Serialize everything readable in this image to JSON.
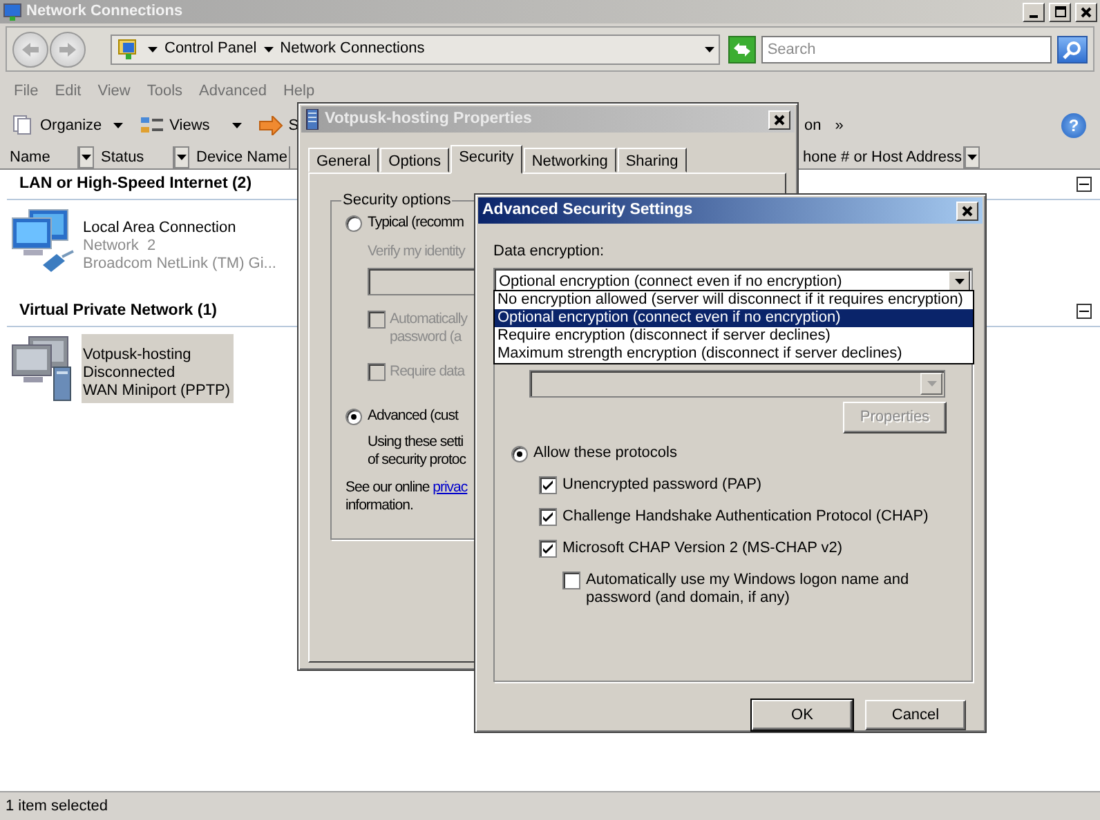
{
  "window": {
    "title": "Network Connections"
  },
  "address_bar": {
    "crumbs": [
      "Control Panel",
      "Network Connections"
    ]
  },
  "search": {
    "placeholder": "Search"
  },
  "menu": [
    "File",
    "Edit",
    "View",
    "Tools",
    "Advanced",
    "Help"
  ],
  "toolbar": [
    {
      "kind": "organize",
      "label": "Organize"
    },
    {
      "kind": "views",
      "label": "Views"
    },
    {
      "kind": "arrow",
      "label": "S"
    },
    {
      "kind": "text",
      "label": "on"
    },
    {
      "kind": "text",
      "label": "»"
    }
  ],
  "help": "?",
  "columns": [
    {
      "label": "Name"
    },
    {
      "label": "Status"
    },
    {
      "label": "Device Name"
    },
    {
      "label": "hone # or Host Address"
    }
  ],
  "groups": [
    {
      "title": "LAN or High-Speed Internet (2)",
      "expanded": true,
      "items": [
        {
          "kind": "lan",
          "name": "Local Area Connection",
          "status": "Network  2",
          "device": "Broadcom NetLink (TM) Gi...",
          "selected": false
        }
      ]
    },
    {
      "title": "Virtual Private Network (1)",
      "expanded": true,
      "items": [
        {
          "kind": "vpn",
          "name": "Votpusk-hosting",
          "status": "Disconnected",
          "device": "WAN Miniport (PPTP)",
          "selected": true
        }
      ]
    }
  ],
  "status_bar": "1 item selected",
  "properties_dialog": {
    "title": "Votpusk-hosting Properties",
    "tabs": [
      {
        "label": "General",
        "selected": false
      },
      {
        "label": "Options",
        "selected": false
      },
      {
        "label": "Security",
        "selected": true
      },
      {
        "label": "Networking",
        "selected": false
      },
      {
        "label": "Sharing",
        "selected": false
      }
    ],
    "group_title": "Security options",
    "typical": {
      "label": "Typical (recomm",
      "selected": false
    },
    "verify": {
      "label": "Verify my identity",
      "disabled": true
    },
    "typical_checks": [
      {
        "label": "Automatically\npassword (a",
        "checked": false,
        "disabled": true
      },
      {
        "label": "Require data",
        "checked": false,
        "disabled": true
      }
    ],
    "advanced": {
      "label": "Advanced (cust",
      "selected": true
    },
    "advanced_note": "Using these setti\nof security protoc",
    "privacy_note": {
      "text": "See our online ",
      "link": "privac",
      "rest": "information."
    }
  },
  "advanced_dialog": {
    "title": "Advanced Security Settings",
    "encryption_label": "Data encryption:",
    "encryption": {
      "value": "Optional encryption (connect even if no encryption)",
      "expanded": true,
      "options": [
        {
          "label": "No encryption allowed (server will disconnect if it requires encryption)",
          "selected": false
        },
        {
          "label": "Optional encryption (connect even if no encryption)",
          "selected": true
        },
        {
          "label": "Require encryption (disconnect if server declines)",
          "selected": false
        },
        {
          "label": "Maximum strength encryption (disconnect if server declines)",
          "selected": false
        }
      ]
    },
    "properties_button": {
      "label": "Properties",
      "disabled": true
    },
    "allow_protocols": {
      "label": "Allow these protocols",
      "selected": true
    },
    "protocols": [
      {
        "label": "Unencrypted password (PAP)",
        "checked": true
      },
      {
        "label": "Challenge Handshake Authentication Protocol (CHAP)",
        "checked": true
      },
      {
        "label": "Microsoft CHAP Version 2 (MS-CHAP v2)",
        "checked": true,
        "children": [
          {
            "label": "Automatically use my Windows logon name and password (and domain, if any)",
            "checked": false
          }
        ]
      }
    ],
    "buttons": [
      {
        "label": "OK",
        "default": true
      },
      {
        "label": "Cancel",
        "default": false
      }
    ]
  }
}
